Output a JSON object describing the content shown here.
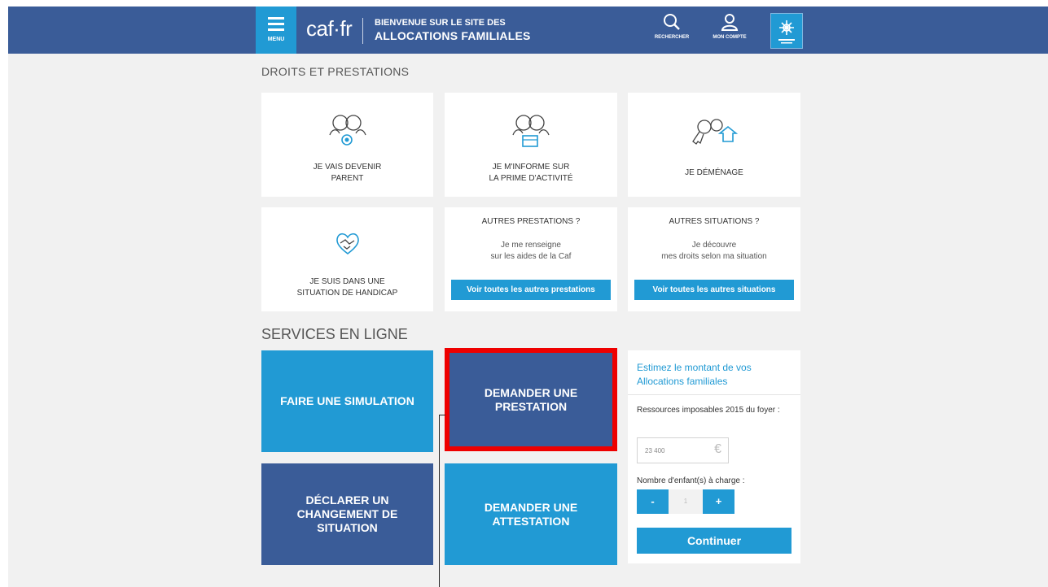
{
  "header": {
    "menu_label": "MENU",
    "logo": "caf·fr",
    "tagline_line1": "BIENVENUE SUR LE SITE DES",
    "tagline_line2": "ALLOCATIONS FAMILIALES",
    "search_label": "RECHERCHER",
    "account_label": "MON COMPTE"
  },
  "droits": {
    "title": "DROITS ET PRESTATIONS",
    "cards": [
      {
        "line1": "JE VAIS DEVENIR",
        "line2": "PARENT",
        "icon": "parents-baby-icon"
      },
      {
        "line1": "JE M'INFORME SUR",
        "line2": "LA PRIME D'ACTIVITÉ",
        "icon": "parents-briefcase-icon"
      },
      {
        "line1": "JE DÉMÉNAGE",
        "line2": "",
        "icon": "keys-house-icon"
      },
      {
        "line1": "JE SUIS DANS UNE",
        "line2": "SITUATION DE HANDICAP",
        "icon": "handshake-heart-icon"
      }
    ],
    "autres_prestations": {
      "heading": "AUTRES PRESTATIONS ?",
      "sub1": "Je me renseigne",
      "sub2": "sur les aides de la Caf",
      "button": "Voir toutes les autres prestations"
    },
    "autres_situations": {
      "heading": "AUTRES SITUATIONS ?",
      "sub1": "Je découvre",
      "sub2": "mes droits selon ma situation",
      "button": "Voir toutes les autres situations"
    }
  },
  "services": {
    "title": "SERVICES EN LIGNE",
    "tiles": {
      "simulation": "FAIRE UNE SIMULATION",
      "prestation_1": "DEMANDER UNE",
      "prestation_2": "PRESTATION",
      "changement_1": "DÉCLARER UN",
      "changement_2": "CHANGEMENT DE",
      "changement_3": "SITUATION",
      "attestation_1": "DEMANDER UNE",
      "attestation_2": "ATTESTATION"
    }
  },
  "estimator": {
    "title": "Estimez le montant de vos Allocations familiales",
    "resources_label": "Ressources imposables 2015 du foyer :",
    "resources_value": "23 400",
    "currency": "€",
    "children_label": "Nombre d'enfant(s) à charge :",
    "minus": "-",
    "children_value": "1",
    "plus": "+",
    "continue": "Continuer"
  },
  "colors": {
    "header_blue": "#3a5c98",
    "accent_blue": "#219ad4",
    "highlight_red": "#ee0000"
  }
}
